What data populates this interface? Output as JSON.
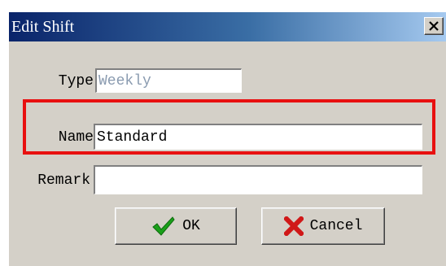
{
  "window": {
    "title": "Edit Shift"
  },
  "icons": {
    "close": "close-icon",
    "ok": "checkmark-icon",
    "cancel": "x-icon"
  },
  "colors": {
    "highlight": "#e81010",
    "checkmark": "#1aa01a",
    "cross": "#d01818"
  },
  "form": {
    "type_label": "Type",
    "type_value": "Weekly",
    "name_label": "Name",
    "name_value": "Standard",
    "remark_label": "Remark",
    "remark_value": ""
  },
  "buttons": {
    "ok_label": "OK",
    "cancel_label": "Cancel"
  }
}
